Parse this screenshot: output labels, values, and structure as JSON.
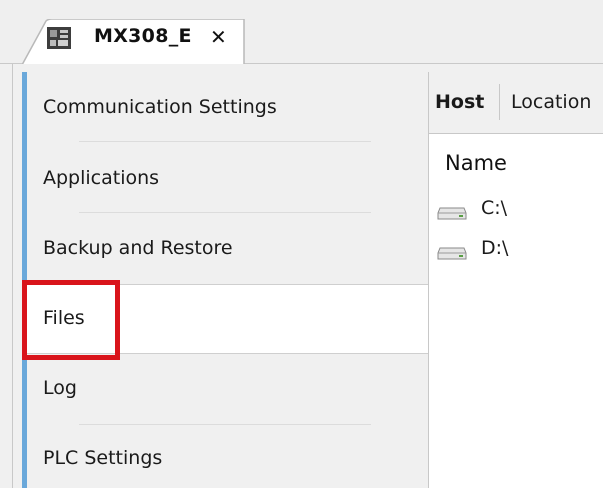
{
  "tab": {
    "title": "MX308_E",
    "close_glyph": "✕",
    "icon": "device-icon"
  },
  "sidebar": {
    "items": [
      {
        "label": "Communication Settings"
      },
      {
        "label": "Applications"
      },
      {
        "label": "Backup and Restore"
      },
      {
        "label": "Files",
        "selected": true
      },
      {
        "label": "Log"
      },
      {
        "label": "PLC Settings"
      }
    ],
    "accent_color": "#6aa8da",
    "highlight_color": "#d9141b"
  },
  "pane": {
    "tabs": [
      {
        "label": "Host"
      },
      {
        "label": "Location"
      }
    ],
    "column_header": "Name",
    "drives": [
      {
        "label": "C:\\",
        "icon": "drive-icon"
      },
      {
        "label": "D:\\",
        "icon": "drive-icon"
      }
    ]
  }
}
